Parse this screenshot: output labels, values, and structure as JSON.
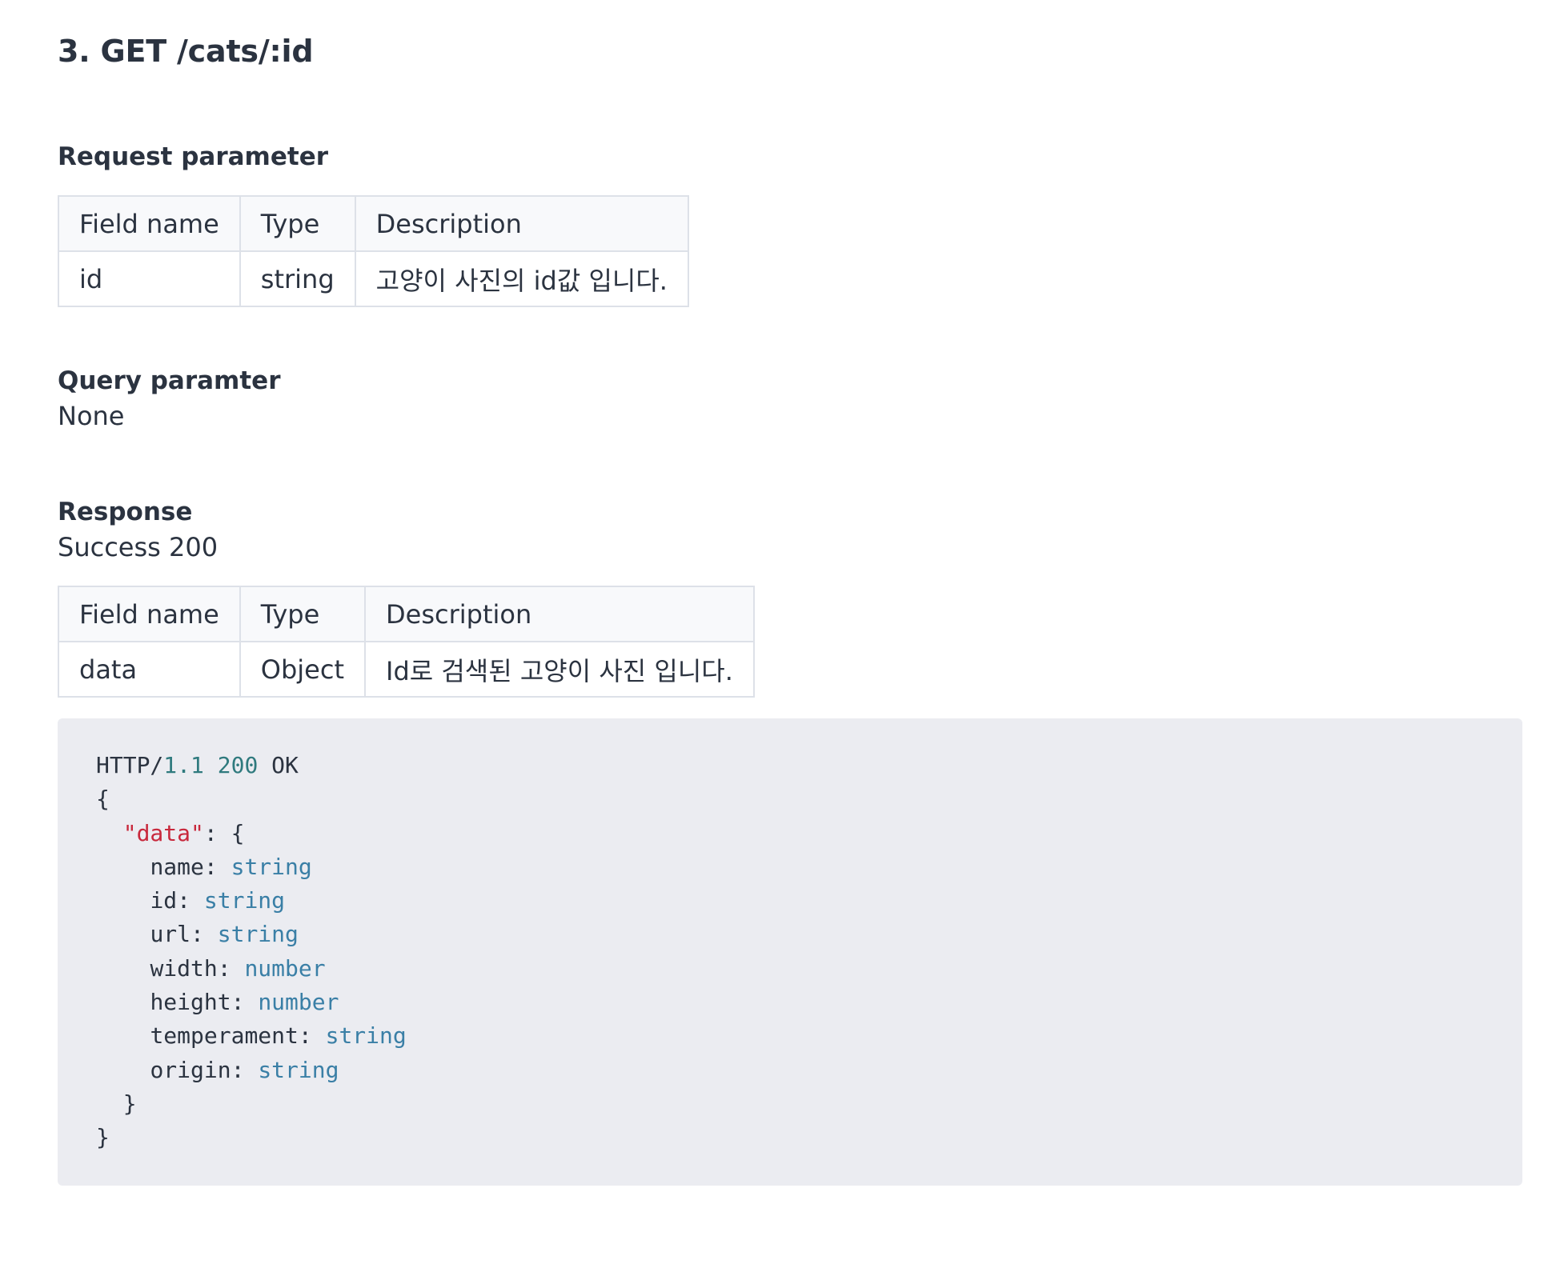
{
  "heading": "3. GET /cats/:id",
  "request_parameter": {
    "title": "Request parameter",
    "columns": [
      "Field name",
      "Type",
      "Description"
    ],
    "rows": [
      [
        "id",
        "string",
        "고양이 사진의 id값 입니다."
      ]
    ]
  },
  "query_parameter": {
    "title": "Query paramter",
    "value": "None"
  },
  "response": {
    "title": "Response",
    "status_text": "Success 200",
    "columns": [
      "Field name",
      "Type",
      "Description"
    ],
    "rows": [
      [
        "data",
        "Object",
        "Id로 검색된 고양이 사진 입니다."
      ]
    ]
  },
  "code": {
    "status_line": {
      "protocol": "HTTP/",
      "version": "1.1",
      "code": "200",
      "reason": "OK"
    },
    "open_brace": "{",
    "data_key": "\"data\"",
    "data_sep": ": {",
    "fields": [
      {
        "key": "name",
        "type": "string"
      },
      {
        "key": "id",
        "type": "string"
      },
      {
        "key": "url",
        "type": "string"
      },
      {
        "key": "width",
        "type": "number"
      },
      {
        "key": "height",
        "type": "number"
      },
      {
        "key": "temperament",
        "type": "string"
      },
      {
        "key": "origin",
        "type": "string"
      }
    ],
    "inner_close": "}",
    "outer_close": "}"
  },
  "colors": {
    "code_background": "#ebecf1",
    "number_token": "#2f7a7e",
    "string_token": "#c8283c",
    "type_token": "#3a7fa6",
    "table_border": "#dde1e8",
    "table_header_bg": "#f8f9fb"
  }
}
